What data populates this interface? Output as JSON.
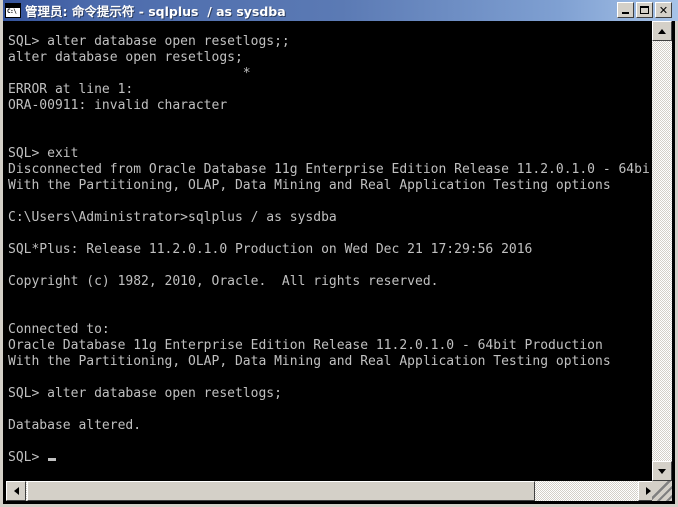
{
  "window": {
    "title": "管理员: 命令提示符 - sqlplus  / as sysdba",
    "icon_name": "console-icon",
    "icon_text": "C:\\",
    "colors": {
      "title_bar_start": "#35549c",
      "title_bar_end": "#a8c4e8",
      "console_background": "#000000",
      "console_foreground": "#c0c0c0",
      "frame": "#d4d0c8"
    }
  },
  "caption_buttons": {
    "minimize_label": "_",
    "maximize_label": "□",
    "close_label": "✕"
  },
  "scrollbars": {
    "vertical": {
      "up_arrow": "▲",
      "down_arrow": "▼"
    },
    "horizontal": {
      "left_arrow": "◀",
      "right_arrow": "▶"
    }
  },
  "console": {
    "lines": [
      "SQL> alter database open resetlogs;;",
      "alter database open resetlogs;",
      "                              *",
      "ERROR at line 1:",
      "ORA-00911: invalid character",
      "",
      "",
      "SQL> exit",
      "Disconnected from Oracle Database 11g Enterprise Edition Release 11.2.0.1.0 - 64bi",
      "With the Partitioning, OLAP, Data Mining and Real Application Testing options",
      "",
      "C:\\Users\\Administrator>sqlplus / as sysdba",
      "",
      "SQL*Plus: Release 11.2.0.1.0 Production on Wed Dec 21 17:29:56 2016",
      "",
      "Copyright (c) 1982, 2010, Oracle.  All rights reserved.",
      "",
      "",
      "Connected to:",
      "Oracle Database 11g Enterprise Edition Release 11.2.0.1.0 - 64bit Production",
      "With the Partitioning, OLAP, Data Mining and Real Application Testing options",
      "",
      "SQL> alter database open resetlogs;",
      "",
      "Database altered.",
      "",
      "SQL> "
    ],
    "cursor_line_index": 26
  }
}
